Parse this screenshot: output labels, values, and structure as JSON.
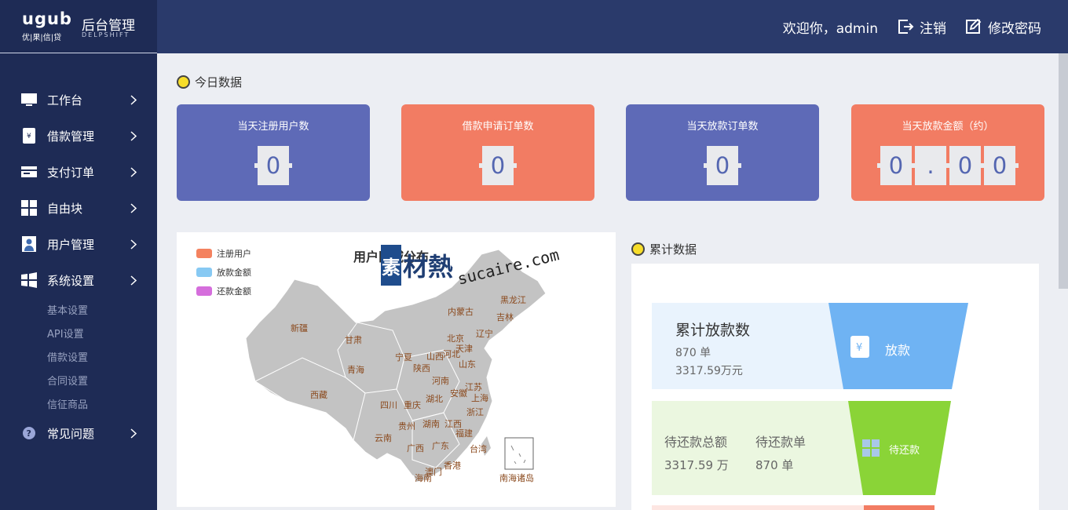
{
  "brand": {
    "logo": "ugub",
    "logo_sub": "优|果|信|贷",
    "title": "后台管理",
    "subtitle": "DELPSHIFT"
  },
  "header": {
    "welcome": "欢迎你，admin",
    "logout": "注销",
    "change_password": "修改密码"
  },
  "sidebar": {
    "items": [
      {
        "label": "工作台",
        "icon": "monitor-icon"
      },
      {
        "label": "借款管理",
        "icon": "receipt-icon"
      },
      {
        "label": "支付订单",
        "icon": "card-icon"
      },
      {
        "label": "自由块",
        "icon": "grid-icon"
      },
      {
        "label": "用户管理",
        "icon": "user-icon"
      },
      {
        "label": "系统设置",
        "icon": "windows-icon"
      }
    ],
    "subitems": [
      "基本设置",
      "API设置",
      "借款设置",
      "合同设置",
      "信征商品"
    ],
    "faq": "常见问题"
  },
  "today": {
    "title": "今日数据",
    "cards": [
      {
        "title": "当天注册用户数",
        "digits": [
          "0"
        ]
      },
      {
        "title": "借款申请订单数",
        "digits": [
          "0"
        ]
      },
      {
        "title": "当天放款订单数",
        "digits": [
          "0"
        ]
      },
      {
        "title": "当天放款金额（约）",
        "digits": [
          "0",
          ".",
          "0",
          "0"
        ]
      }
    ]
  },
  "map": {
    "title": "用户区域分布",
    "legend": [
      "注册用户",
      "放款金额",
      "还款金额"
    ],
    "legend_colors": [
      "#f4825f",
      "#87c9f3",
      "#d56edc"
    ],
    "provinces": [
      "黑龙江",
      "内蒙古",
      "吉林",
      "新疆",
      "辽宁",
      "甘肃",
      "北京",
      "天津",
      "宁夏",
      "山西",
      "河北",
      "青海",
      "陕西",
      "山东",
      "河南",
      "西藏",
      "江苏",
      "安徽",
      "湖北",
      "上海",
      "四川",
      "重庆",
      "浙江",
      "贵州",
      "湖南",
      "江西",
      "福建",
      "云南",
      "广西",
      "广东",
      "台湾",
      "香港",
      "澳门",
      "海南",
      "南海诸岛"
    ],
    "watermark": {
      "box": "素",
      "cn": "材熱",
      "en": "sucaire.com"
    }
  },
  "accum": {
    "title": "累计数据",
    "loan": {
      "title": "累计放款数",
      "count": "870 单",
      "amount": "3317.59万元",
      "tag": "放款"
    },
    "repay": {
      "label1": "待还款总额",
      "value1": "3317.59 万",
      "label2": "待还款单",
      "value2": "870 单",
      "tag": "待还款"
    }
  },
  "colors": {
    "header": "#2a3a6b",
    "sidebar": "#1e2b55",
    "card_blue": "#5e6ab7",
    "card_orange": "#f27c63",
    "funnel_blue": "#6fb3f3",
    "funnel_green": "#8ad437"
  }
}
